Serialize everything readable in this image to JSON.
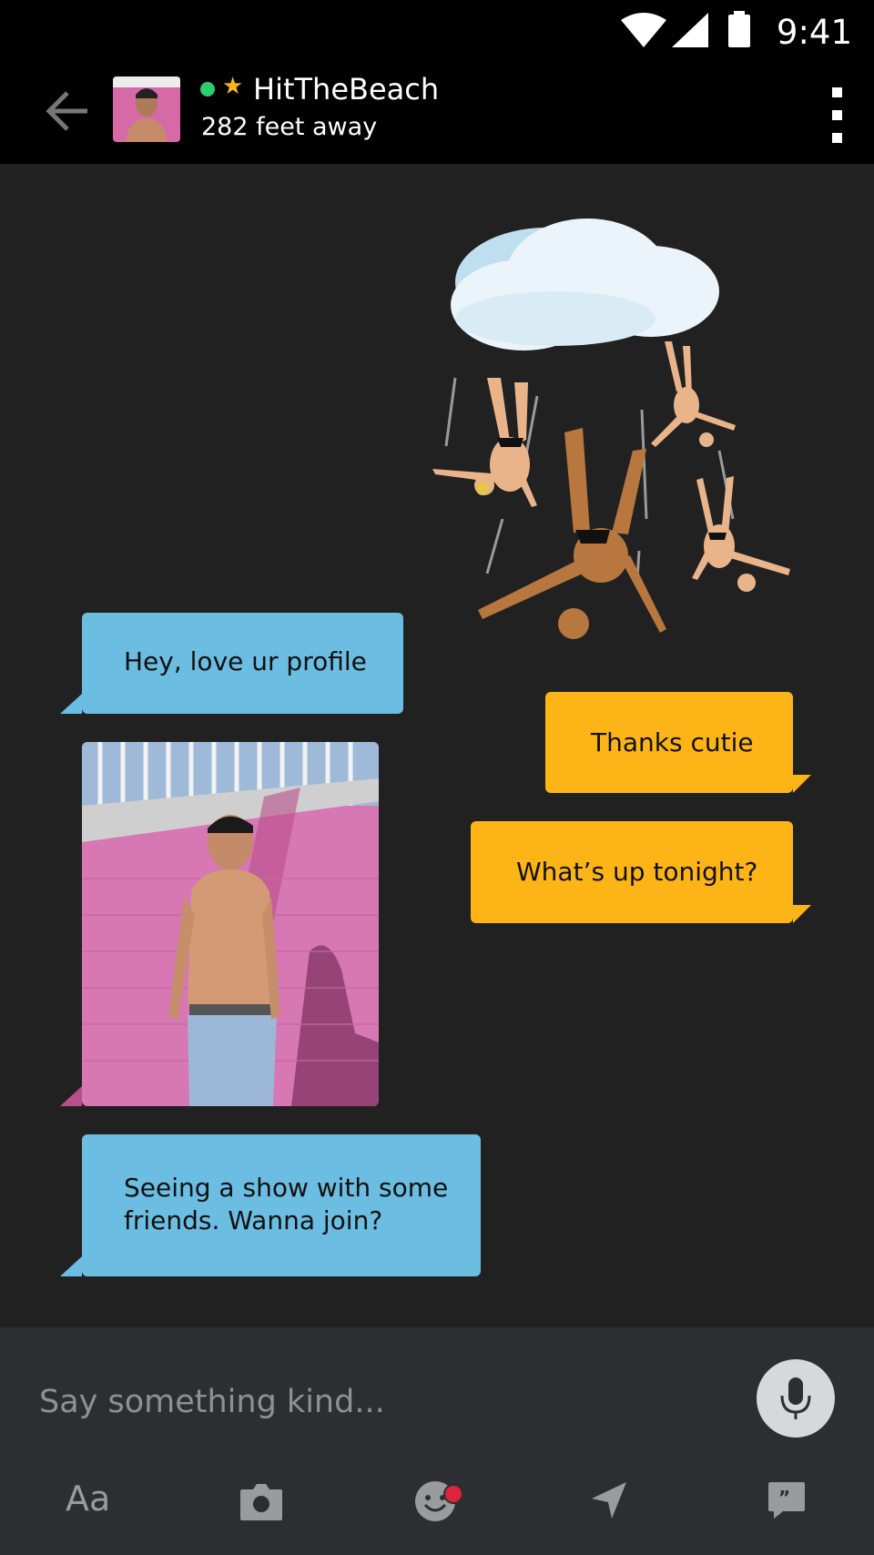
{
  "status_bar": {
    "time": "9:41"
  },
  "header": {
    "username": "HitTheBeach",
    "distance": "282 feet away",
    "online_color": "#2ecc71",
    "favorite_color": "#fdb714"
  },
  "messages": [
    {
      "from": "them",
      "type": "text",
      "text": "Hey, love ur profile"
    },
    {
      "from": "me",
      "type": "text",
      "text": "Thanks cutie"
    },
    {
      "from": "me",
      "type": "text",
      "text": "What’s up tonight?"
    },
    {
      "from": "them",
      "type": "photo",
      "icon": "profile-photo"
    },
    {
      "from": "them",
      "type": "text",
      "text": "Seeing a show with some friends. Wanna join?"
    }
  ],
  "sticker": {
    "icon": "raining-men-sticker"
  },
  "composer": {
    "placeholder": "Say something kind...",
    "toolbar": {
      "text_label": "Aa",
      "items": [
        "text-format",
        "camera",
        "sticker",
        "location",
        "saved-phrases"
      ]
    }
  },
  "colors": {
    "incoming_bubble": "#6bbde1",
    "outgoing_bubble": "#fdb416",
    "background": "#212121",
    "notification_dot": "#e0233c"
  }
}
